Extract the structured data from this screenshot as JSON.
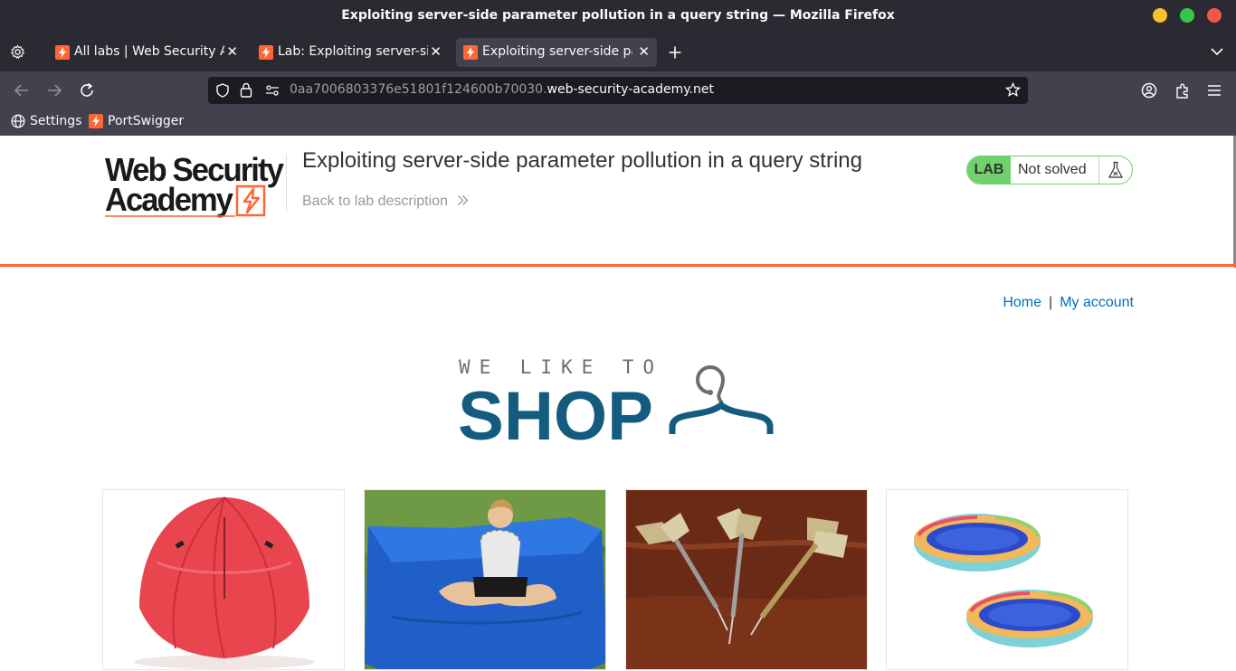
{
  "window": {
    "title": "Exploiting server-side parameter pollution in a query string — Mozilla Firefox"
  },
  "tabs": [
    {
      "label": "All labs | Web Security Academy",
      "active": false
    },
    {
      "label": "Lab: Exploiting server-side parameter pollution in a query string",
      "active": false
    },
    {
      "label": "Exploiting server-side parameter pollution in a query string",
      "active": true
    }
  ],
  "address_bar": {
    "url_dim": "0aa7006803376e51801f124600b70030.",
    "url_domain": "web-security-academy.net"
  },
  "bookmarks": [
    {
      "label": "Settings",
      "icon": "globe-icon"
    },
    {
      "label": "PortSwigger",
      "icon": "portswigger-icon"
    }
  ],
  "header": {
    "logo_line1": "Web Security",
    "logo_line2": "Academy",
    "lab_title": "Exploiting server-side parameter pollution in a query string",
    "back_link": "Back to lab description",
    "lab_badge": "LAB",
    "lab_status": "Not solved"
  },
  "nav": {
    "home": "Home",
    "separator": "|",
    "account": "My account"
  },
  "shop_logo": {
    "line1": "WE LIKE TO",
    "line2": "SHOP"
  },
  "products": [
    {
      "image": "red-umbrella"
    },
    {
      "image": "blue-bean-bag-with-girl"
    },
    {
      "image": "darts"
    },
    {
      "image": "paddling-pools"
    }
  ],
  "colors": {
    "accent_orange": "#ff6633",
    "solved_green": "#70d16d",
    "link_blue": "#0071bc",
    "shop_blue": "#135c7f"
  }
}
